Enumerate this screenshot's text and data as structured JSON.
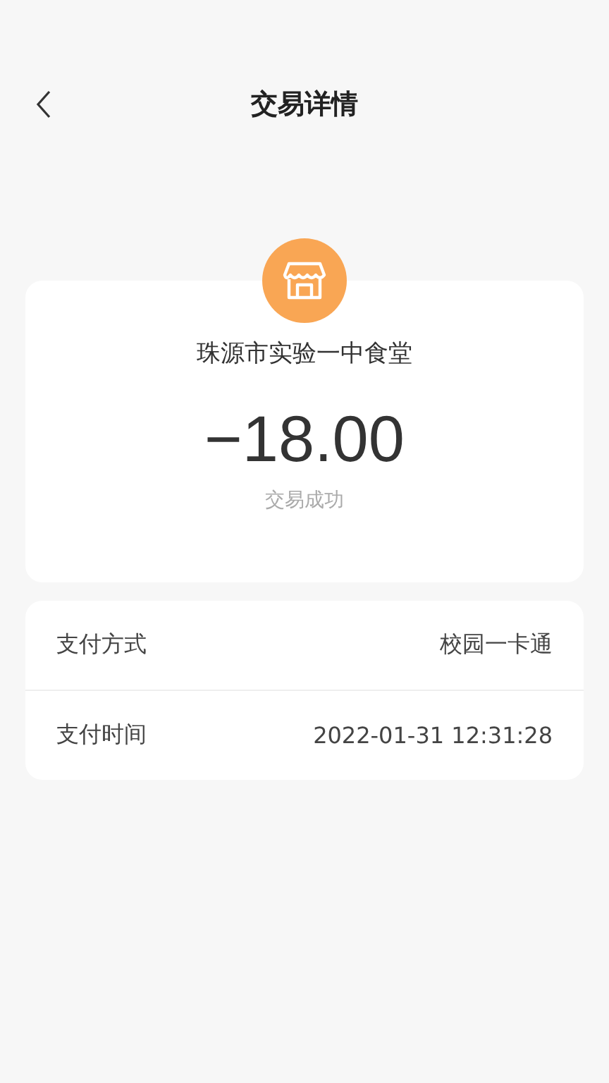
{
  "header": {
    "title": "交易详情"
  },
  "summary": {
    "merchant": "珠源市实验一中食堂",
    "amount": "−18.00",
    "status": "交易成功"
  },
  "details": [
    {
      "label": "支付方式",
      "value": "校园一卡通"
    },
    {
      "label": "支付时间",
      "value": "2022-01-31  12:31:28"
    }
  ]
}
